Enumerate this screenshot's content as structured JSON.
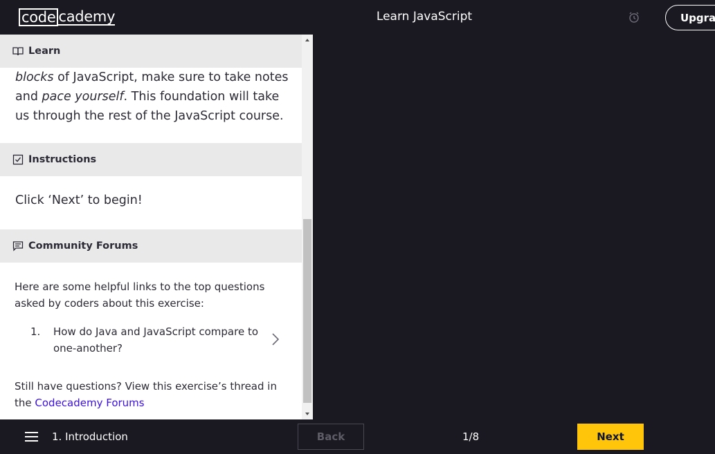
{
  "header": {
    "logo_boxed": "code",
    "logo_rest": "cademy",
    "course_title": "Learn JavaScript",
    "upgrade_label": "Upgrade"
  },
  "panel": {
    "learn": {
      "heading": "Learn",
      "text_blocks": "blocks",
      "text_part1": " of JavaScript, make sure to take notes and ",
      "text_pace": "pace yourself",
      "text_part2": ". This foundation will take us through the rest of the JavaScript course."
    },
    "instructions": {
      "heading": "Instructions",
      "text": "Click ‘Next’ to begin!"
    },
    "forums": {
      "heading": "Community Forums",
      "intro": "Here are some helpful links to the top questions asked by coders about this exercise:",
      "items": [
        {
          "number": "1.",
          "text": "How do Java and JavaScript compare to one-another?"
        }
      ],
      "outro": "Still have questions? View this exercise’s thread in the ",
      "link_text": "Codecademy Forums"
    }
  },
  "footer": {
    "lesson_label": "1. Introduction",
    "back_label": "Back",
    "progress": "1/8",
    "next_label": "Next"
  },
  "colors": {
    "background": "#1a1820",
    "accent_yellow": "#ffc50b",
    "link_blue": "#3a10e5",
    "header_gray": "#e9e9ea"
  },
  "icons": {
    "learn": "book-icon",
    "instructions": "checkbox-icon",
    "forums": "chat-icon",
    "alarm": "alarm-clock-icon",
    "menu": "hamburger-icon",
    "item_chevron": "chevron-right-icon"
  }
}
